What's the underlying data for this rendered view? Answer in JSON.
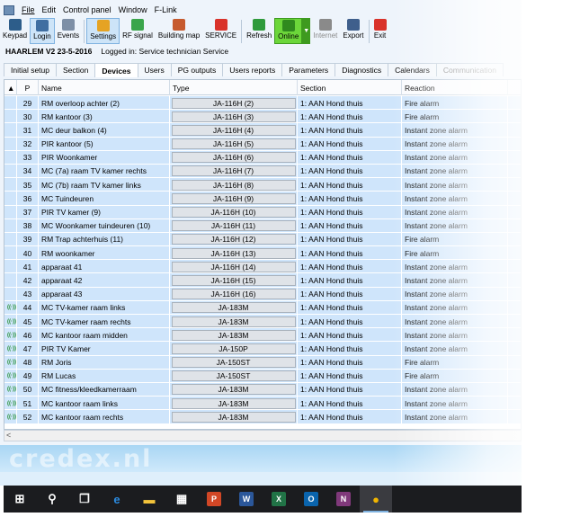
{
  "menu": [
    "File",
    "Edit",
    "Control panel",
    "Window",
    "F-Link"
  ],
  "toolbar": [
    {
      "label": "Keypad",
      "icon": "keypad-icon",
      "color": "#2d5d8a"
    },
    {
      "label": "Login",
      "icon": "login-icon",
      "color": "#3f6ea1",
      "active": true
    },
    {
      "label": "Events",
      "icon": "events-icon",
      "color": "#7d8fa6"
    },
    {
      "label": "Settings",
      "icon": "settings-icon",
      "color": "#e5a323",
      "active": true
    },
    {
      "label": "RF signal",
      "icon": "rf-signal-icon",
      "color": "#3aa54b"
    },
    {
      "label": "Building map",
      "icon": "building-map-icon",
      "color": "#c65a2e"
    },
    {
      "label": "SERVICE",
      "icon": "service-icon",
      "color": "#d9322a"
    },
    {
      "label": "Refresh",
      "icon": "refresh-icon",
      "color": "#2f9a3b"
    },
    {
      "label": "Online",
      "icon": "online-icon",
      "color": "#2f8a1e",
      "online": true
    },
    {
      "label": "Internet",
      "icon": "internet-icon",
      "color": "#8a8a8a",
      "disabled": true
    },
    {
      "label": "Export",
      "icon": "export-icon",
      "color": "#3f5f8c"
    },
    {
      "label": "Exit",
      "icon": "exit-icon",
      "color": "#d9322a"
    }
  ],
  "info": {
    "site": "HAARLEM V2 23-5-2016",
    "login": "Logged in: Service technician Service"
  },
  "tabs": [
    "Initial setup",
    "Section",
    "Devices",
    "Users",
    "PG outputs",
    "Users reports",
    "Parameters",
    "Diagnostics",
    "Calendars",
    "Communication"
  ],
  "active_tab": "Devices",
  "columns": {
    "p": "P",
    "name": "Name",
    "type": "Type",
    "section": "Section",
    "reaction": "Reaction"
  },
  "rows": [
    {
      "p": "29",
      "name": "RM overloop achter (2)",
      "type": "JA-116H (2)",
      "section": "1: AAN Hond thuis",
      "reaction": "Fire alarm",
      "rf": false
    },
    {
      "p": "30",
      "name": "RM kantoor (3)",
      "type": "JA-116H (3)",
      "section": "1: AAN Hond thuis",
      "reaction": "Fire alarm",
      "rf": false
    },
    {
      "p": "31",
      "name": "MC deur balkon (4)",
      "type": "JA-116H (4)",
      "section": "1: AAN Hond thuis",
      "reaction": "Instant zone alarm",
      "rf": false
    },
    {
      "p": "32",
      "name": "PIR kantoor (5)",
      "type": "JA-116H (5)",
      "section": "1: AAN Hond thuis",
      "reaction": "Instant zone alarm",
      "rf": false
    },
    {
      "p": "33",
      "name": "PIR Woonkamer",
      "type": "JA-116H (6)",
      "section": "1: AAN Hond thuis",
      "reaction": "Instant zone alarm",
      "rf": false
    },
    {
      "p": "34",
      "name": "MC (7a) raam TV kamer rechts",
      "type": "JA-116H (7)",
      "section": "1: AAN Hond thuis",
      "reaction": "Instant zone alarm",
      "rf": false
    },
    {
      "p": "35",
      "name": "MC (7b) raam TV kamer links",
      "type": "JA-116H (8)",
      "section": "1: AAN Hond thuis",
      "reaction": "Instant zone alarm",
      "rf": false
    },
    {
      "p": "36",
      "name": "MC Tuindeuren",
      "type": "JA-116H (9)",
      "section": "1: AAN Hond thuis",
      "reaction": "Instant zone alarm",
      "rf": false
    },
    {
      "p": "37",
      "name": "PIR TV kamer (9)",
      "type": "JA-116H (10)",
      "section": "1: AAN Hond thuis",
      "reaction": "Instant zone alarm",
      "rf": false
    },
    {
      "p": "38",
      "name": "MC Woonkamer tuindeuren (10)",
      "type": "JA-116H (11)",
      "section": "1: AAN Hond thuis",
      "reaction": "Instant zone alarm",
      "rf": false
    },
    {
      "p": "39",
      "name": "RM Trap achterhuis (11)",
      "type": "JA-116H (12)",
      "section": "1: AAN Hond thuis",
      "reaction": "Fire alarm",
      "rf": false
    },
    {
      "p": "40",
      "name": "RM woonkamer",
      "type": "JA-116H (13)",
      "section": "1: AAN Hond thuis",
      "reaction": "Fire alarm",
      "rf": false
    },
    {
      "p": "41",
      "name": "apparaat 41",
      "type": "JA-116H (14)",
      "section": "1: AAN Hond thuis",
      "reaction": "Instant zone alarm",
      "rf": false
    },
    {
      "p": "42",
      "name": "apparaat 42",
      "type": "JA-116H (15)",
      "section": "1: AAN Hond thuis",
      "reaction": "Instant zone alarm",
      "rf": false
    },
    {
      "p": "43",
      "name": "apparaat 43",
      "type": "JA-116H (16)",
      "section": "1: AAN Hond thuis",
      "reaction": "Instant zone alarm",
      "rf": false
    },
    {
      "p": "44",
      "name": "MC TV-kamer raam links",
      "type": "JA-183M",
      "section": "1: AAN Hond thuis",
      "reaction": "Instant zone alarm",
      "rf": true
    },
    {
      "p": "45",
      "name": "MC TV-kamer raam rechts",
      "type": "JA-183M",
      "section": "1: AAN Hond thuis",
      "reaction": "Instant zone alarm",
      "rf": true
    },
    {
      "p": "46",
      "name": "MC kantoor raam midden",
      "type": "JA-183M",
      "section": "1: AAN Hond thuis",
      "reaction": "Instant zone alarm",
      "rf": true
    },
    {
      "p": "47",
      "name": "PIR TV Kamer",
      "type": "JA-150P",
      "section": "1: AAN Hond thuis",
      "reaction": "Instant zone alarm",
      "rf": true
    },
    {
      "p": "48",
      "name": "RM Joris",
      "type": "JA-150ST",
      "section": "1: AAN Hond thuis",
      "reaction": "Fire alarm",
      "rf": true
    },
    {
      "p": "49",
      "name": "RM Lucas",
      "type": "JA-150ST",
      "section": "1: AAN Hond thuis",
      "reaction": "Fire alarm",
      "rf": true
    },
    {
      "p": "50",
      "name": "MC fitness/kleedkamerraam",
      "type": "JA-183M",
      "section": "1: AAN Hond thuis",
      "reaction": "Instant zone alarm",
      "rf": true
    },
    {
      "p": "51",
      "name": "MC kantoor raam links",
      "type": "JA-183M",
      "section": "1: AAN Hond thuis",
      "reaction": "Instant zone alarm",
      "rf": true
    },
    {
      "p": "52",
      "name": "MC kantoor raam rechts",
      "type": "JA-183M",
      "section": "1: AAN Hond thuis",
      "reaction": "Instant zone alarm",
      "rf": true
    }
  ],
  "watermark": "credex.nl",
  "taskbar": [
    {
      "name": "start-icon",
      "color": "#ffffff",
      "glyph": "⊞"
    },
    {
      "name": "search-icon",
      "color": "#ffffff",
      "glyph": "⚲"
    },
    {
      "name": "task-view-icon",
      "color": "#ffffff",
      "glyph": "❐"
    },
    {
      "name": "edge-icon",
      "color": "#2b8be0",
      "glyph": "e"
    },
    {
      "name": "file-explorer-icon",
      "color": "#f3c33b",
      "glyph": "▬"
    },
    {
      "name": "store-icon",
      "color": "#ffffff",
      "glyph": "▦"
    },
    {
      "name": "powerpoint-icon",
      "color": "#d24726",
      "glyph": "P"
    },
    {
      "name": "word-icon",
      "color": "#2b579a",
      "glyph": "W"
    },
    {
      "name": "excel-icon",
      "color": "#217346",
      "glyph": "X"
    },
    {
      "name": "outlook-icon",
      "color": "#0a64ad",
      "glyph": "O"
    },
    {
      "name": "onenote-icon",
      "color": "#80397b",
      "glyph": "N"
    },
    {
      "name": "jablotron-app-icon",
      "color": "#f0b400",
      "glyph": "●",
      "active": true
    }
  ]
}
